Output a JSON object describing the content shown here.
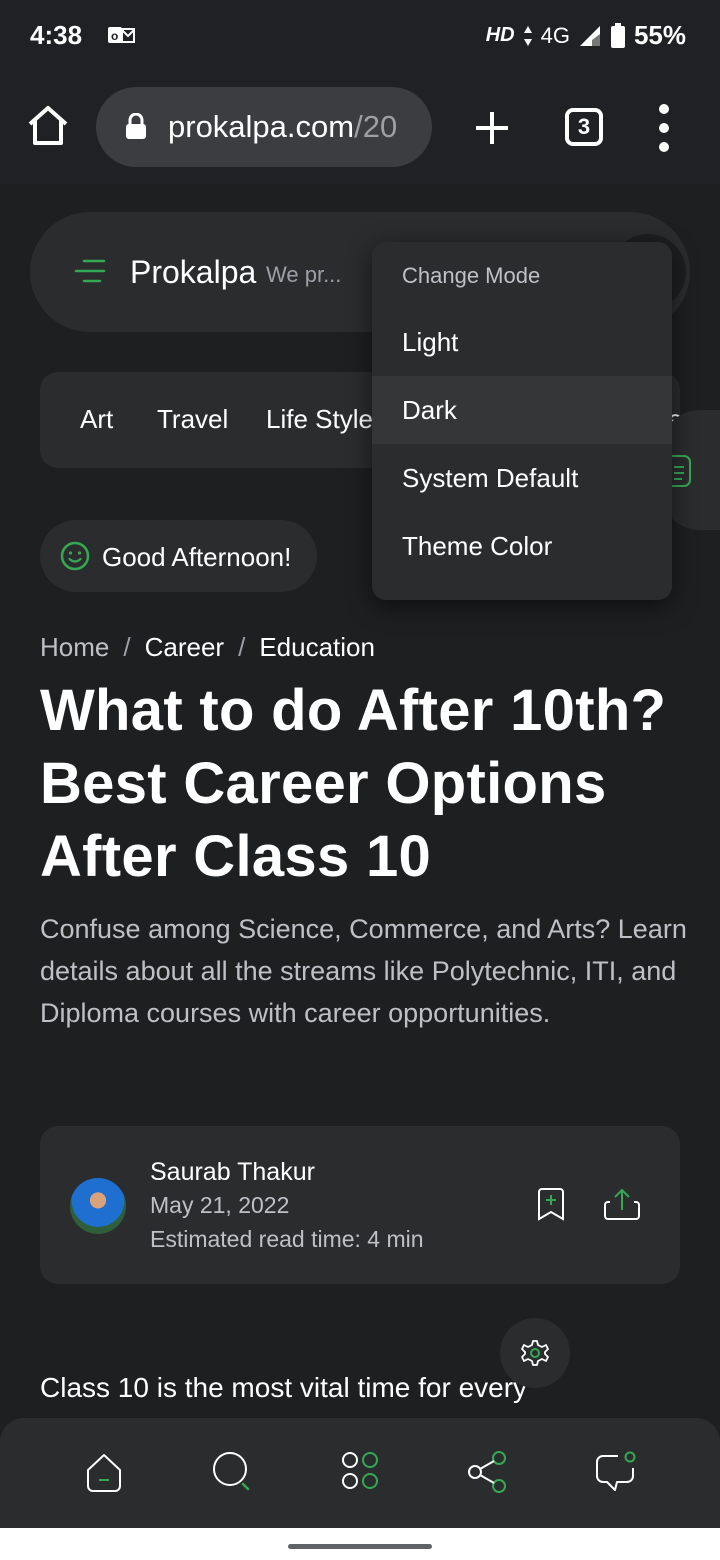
{
  "status_bar": {
    "time": "4:38",
    "network": "4G",
    "hd_label": "HD",
    "battery": "55%"
  },
  "browser": {
    "url_host": "prokalpa.com",
    "url_path": "/20",
    "tab_count": "3"
  },
  "site": {
    "name": "Prokalpa",
    "tagline": "We pr..."
  },
  "categories": [
    "Art",
    "Travel",
    "Life Style"
  ],
  "category_overflow": "e",
  "greeting": "Good Afternoon!",
  "breadcrumb": {
    "home": "Home",
    "sep1": "/",
    "level1": "Career",
    "sep2": "/",
    "level2": "Education"
  },
  "article": {
    "title": "What to do After 10th? Best Career Options After Class 10",
    "summary": "Confuse among Science, Commerce, and Arts? Learn details about all the streams like Polytechnic, ITI, and Diploma courses with career opportunities.",
    "author": "Saurab Thakur",
    "date": "May 21, 2022",
    "read_time": "Estimated read time: 4 min",
    "body_start": "Class 10 is the most vital time for every"
  },
  "mode_menu": {
    "title": "Change Mode",
    "items": [
      "Light",
      "Dark",
      "System Default",
      "Theme Color"
    ],
    "selected": "Dark"
  },
  "colors": {
    "accent": "#34a853",
    "background": "#1e1f20",
    "surface": "#2b2c2e"
  },
  "bottom_nav": [
    "home-icon",
    "search-icon",
    "apps-icon",
    "share-network-icon",
    "chat-icon"
  ]
}
